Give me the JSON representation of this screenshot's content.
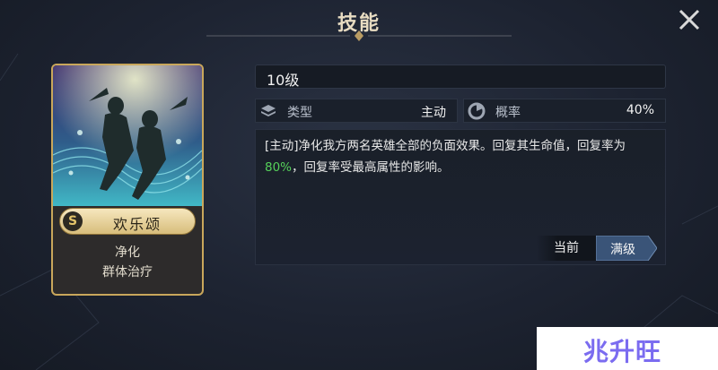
{
  "header": {
    "title": "技能"
  },
  "skill_card": {
    "rank": "S",
    "name": "欢乐颂",
    "tag1": "净化",
    "tag2": "群体治疗"
  },
  "level": "10级",
  "stats": {
    "type_label": "类型",
    "type_value": "主动",
    "chance_label": "概率",
    "chance_value": "40%"
  },
  "description": {
    "part1": "[主动]净化我方两名英雄全部的负面效果。回复其生命值，回复率为",
    "highlight": "80%",
    "part2": "，回复率受最高属性的影响。",
    "highlight_color": "#55d05a"
  },
  "buttons": {
    "current": "当前",
    "max": "满级"
  },
  "watermark": "兆升旺",
  "colors": {
    "gold_border": "#c9a75b",
    "accent_blue": "#3a5478"
  }
}
